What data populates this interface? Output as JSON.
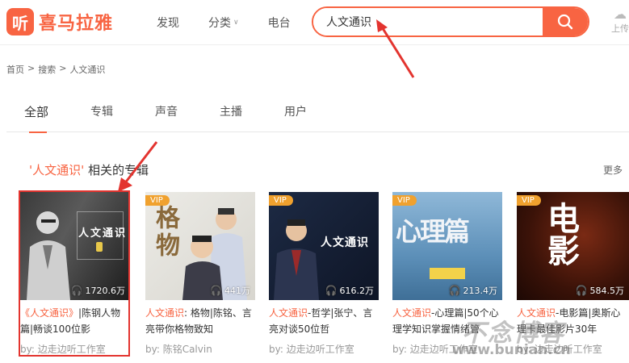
{
  "header": {
    "logo_mark": "听",
    "logo_text": "喜马拉雅",
    "nav": [
      {
        "label": "发现"
      },
      {
        "label": "分类"
      },
      {
        "label": "电台"
      }
    ],
    "search_value": "人文通识",
    "upload_label": "上传"
  },
  "breadcrumb": [
    "首页",
    ">",
    "搜索",
    ">",
    "人文通识"
  ],
  "tabs": [
    "全部",
    "专辑",
    "声音",
    "主播",
    "用户"
  ],
  "section": {
    "quote_open": "'",
    "keyword": "人文通识",
    "quote_close": "'",
    "suffix": " 相关的专辑",
    "more": "更多"
  },
  "cards": [
    {
      "vip": "",
      "cover_text": "人文通识",
      "plays": "1720.6万",
      "title_hl": "《人文通识》",
      "title_rest": "|陈钢人物篇|畅谈100位影",
      "author": "by: 边走边听工作室"
    },
    {
      "vip": "VIP",
      "cover_text": "格物",
      "plays": "441万",
      "title_hl": "人文通识",
      "title_rest": ": 格物|陈铭、言亮带你格物致知",
      "author": "by: 陈铭Calvin"
    },
    {
      "vip": "VIP",
      "cover_text": "人文通识",
      "plays": "616.2万",
      "title_hl": "人文通识",
      "title_rest": "-哲学|张宁、言亮对谈50位哲",
      "author": "by: 边走边听工作室"
    },
    {
      "vip": "VIP",
      "cover_text": "心理篇",
      "plays": "213.4万",
      "title_hl": "人文通识",
      "title_rest": "-心理篇|50个心理学知识掌握情绪管",
      "author": "by: 边走边听工作室"
    },
    {
      "vip": "VIP",
      "cover_text": "电影",
      "plays": "584.5万",
      "title_hl": "人文通识",
      "title_rest": "-电影篇|奥斯心理卡最佳影片30年",
      "author": "by: 边走边听工作室"
    }
  ],
  "watermark": {
    "big": "不念博客",
    "small": "www.bunian.cn"
  },
  "colors": {
    "brand": "#f86442",
    "vip": "#f0a12e",
    "annotation_red": "#e3342f"
  }
}
